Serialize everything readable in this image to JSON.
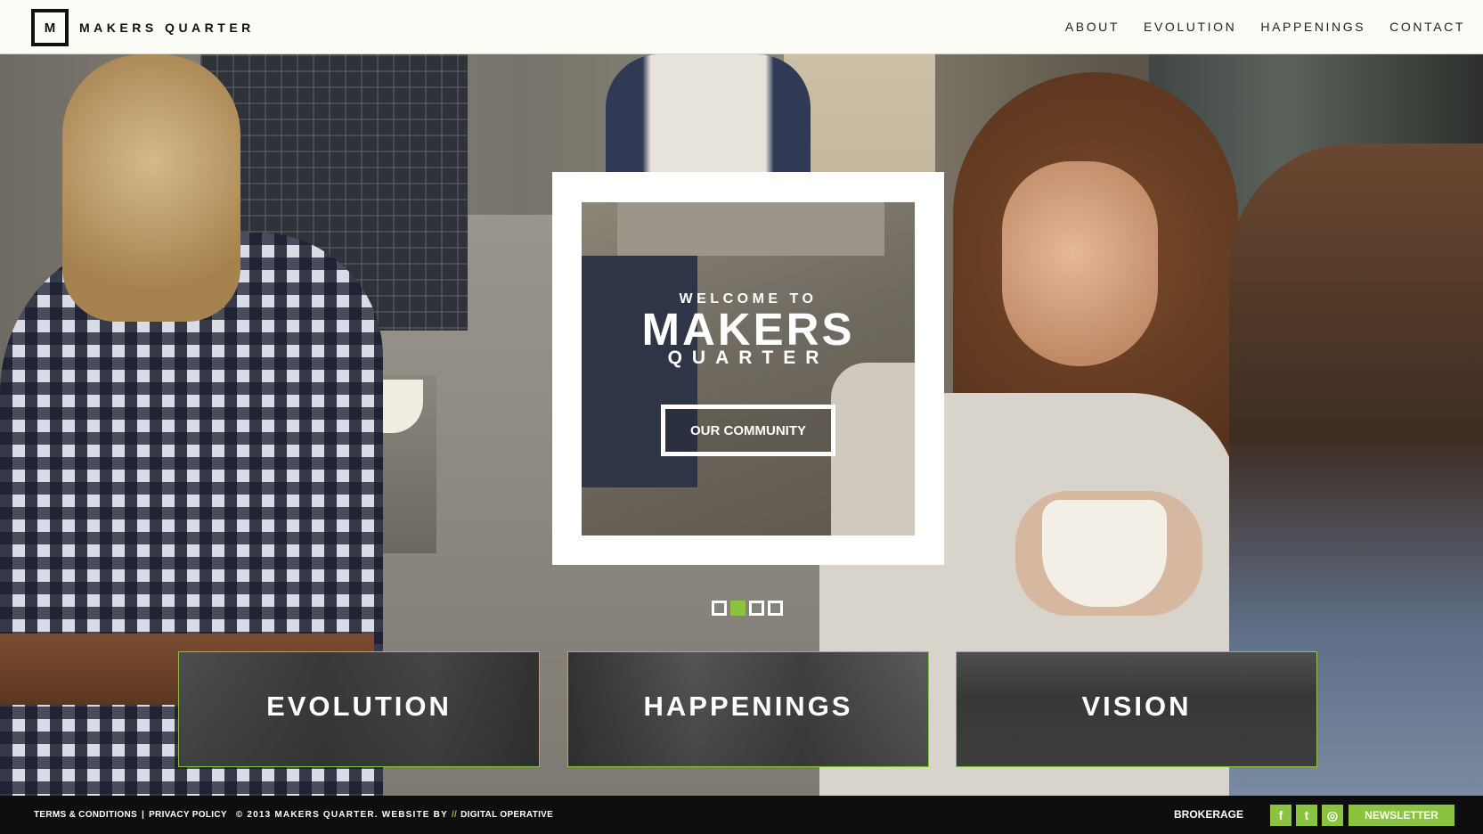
{
  "brand": {
    "mark": "M",
    "name": "MAKERS QUARTER"
  },
  "nav": {
    "items": [
      {
        "label": "ABOUT"
      },
      {
        "label": "EVOLUTION"
      },
      {
        "label": "HAPPENINGS"
      },
      {
        "label": "CONTACT"
      }
    ]
  },
  "hero": {
    "welcome_top": "WELCOME TO",
    "welcome_main": "MAKERS",
    "welcome_sub": "QUARTER",
    "cta_label": "OUR COMMUNITY",
    "slides": {
      "count": 4,
      "active_index": 1
    }
  },
  "tiles": [
    {
      "label": "EVOLUTION"
    },
    {
      "label": "HAPPENINGS"
    },
    {
      "label": "VISION"
    }
  ],
  "footer": {
    "terms": "TERMS & CONDITIONS",
    "separator": "|",
    "privacy": "PRIVACY POLICY",
    "copyright": "© 2013 MAKERS QUARTER. WEBSITE BY",
    "slashes": "//",
    "agency": "DIGITAL OPERATIVE",
    "brokerage": "BROKERAGE",
    "social": [
      {
        "icon": "facebook-icon",
        "glyph": "f"
      },
      {
        "icon": "twitter-icon",
        "glyph": "t"
      },
      {
        "icon": "instagram-icon",
        "glyph": "◎"
      }
    ],
    "newsletter": "NEWSLETTER"
  },
  "colors": {
    "accent": "#8ac43f",
    "header_bg": "#fdfdf8",
    "footer_bg": "#0e0e0e"
  }
}
